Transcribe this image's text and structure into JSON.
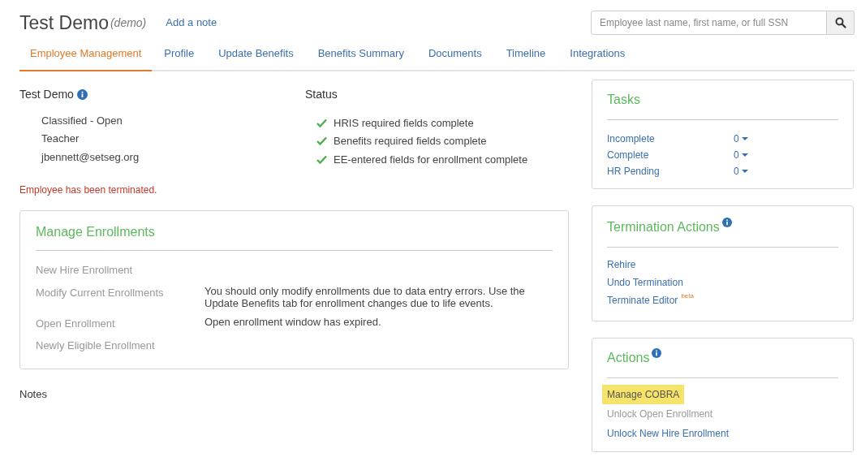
{
  "header": {
    "title": "Test Demo",
    "subtitle": "(demo)",
    "add_note": "Add a note",
    "search": {
      "placeholder": "Employee last name, first name, or full SSN"
    }
  },
  "tabs": [
    {
      "label": "Employee Management",
      "selected": true
    },
    {
      "label": "Profile",
      "selected": false
    },
    {
      "label": "Update Benefits",
      "selected": false
    },
    {
      "label": "Benefits Summary",
      "selected": false
    },
    {
      "label": "Documents",
      "selected": false
    },
    {
      "label": "Timeline",
      "selected": false
    },
    {
      "label": "Integrations",
      "selected": false
    }
  ],
  "employee": {
    "name": "Test Demo",
    "details": [
      "Classified - Open",
      "Teacher",
      "jbennett@setseg.org"
    ],
    "alert": "Employee has been terminated."
  },
  "status": {
    "title": "Status",
    "items": [
      {
        "label": "HRIS required fields complete",
        "complete": true
      },
      {
        "label": "Benefits required fields complete",
        "complete": true
      },
      {
        "label": "EE-entered fields for enrollment complete",
        "complete": true
      }
    ]
  },
  "manage_enrollments": {
    "title": "Manage Enrollments",
    "items": [
      {
        "label": "New Hire Enrollment",
        "disabled": true
      },
      {
        "label": "Modify Current Enrollments",
        "disabled": true,
        "note": "You should only modify enrollments due to data entry errors. Use the Update Benefits tab for enrollment changes due to life events."
      },
      {
        "label": "Open Enrollment",
        "disabled": true,
        "note": "Open enrollment window has expired."
      },
      {
        "label": "Newly Eligible Enrollment",
        "disabled": true
      }
    ]
  },
  "notes": {
    "title": "Notes"
  },
  "tasks": {
    "title": "Tasks",
    "rows": [
      {
        "label": "Incomplete",
        "count": "0"
      },
      {
        "label": "Complete",
        "count": "0"
      },
      {
        "label": "HR Pending",
        "count": "0"
      }
    ]
  },
  "termination_actions": {
    "title": "Termination Actions",
    "items": [
      {
        "label": "Rehire"
      },
      {
        "label": "Undo Termination"
      },
      {
        "label": "Terminate Editor",
        "badge": "beta"
      }
    ]
  },
  "actions": {
    "title": "Actions",
    "items": [
      {
        "label": "Manage COBRA",
        "highlighted": true,
        "disabled": false
      },
      {
        "label": "Unlock Open Enrollment",
        "highlighted": false,
        "disabled": true
      },
      {
        "label": "Unlock New Hire Enrollment",
        "highlighted": false,
        "disabled": false
      }
    ]
  }
}
